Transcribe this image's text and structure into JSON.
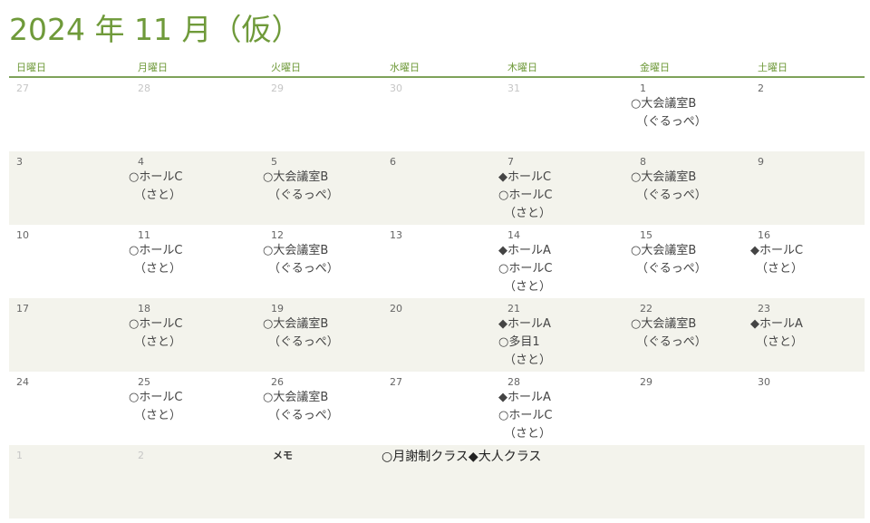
{
  "title": "2024 年 11 月（仮）",
  "weekdays": [
    "日曜日",
    "月曜日",
    "火曜日",
    "水曜日",
    "木曜日",
    "金曜日",
    "土曜日"
  ],
  "weeks": [
    {
      "shaded": false,
      "days": [
        {
          "num": "27",
          "faded": true,
          "entries": []
        },
        {
          "num": "28",
          "faded": true,
          "entries": []
        },
        {
          "num": "29",
          "faded": true,
          "entries": []
        },
        {
          "num": "30",
          "faded": true,
          "entries": []
        },
        {
          "num": "31",
          "faded": true,
          "entries": []
        },
        {
          "num": "1",
          "faded": false,
          "entries": [
            "○大会議室B",
            "（ぐるっぺ）"
          ]
        },
        {
          "num": "2",
          "faded": false,
          "entries": []
        }
      ]
    },
    {
      "shaded": true,
      "days": [
        {
          "num": "3",
          "faded": false,
          "entries": []
        },
        {
          "num": "4",
          "faded": false,
          "entries": [
            "○ホールC",
            "（さと）"
          ]
        },
        {
          "num": "5",
          "faded": false,
          "entries": [
            "○大会議室B",
            "（ぐるっぺ）"
          ]
        },
        {
          "num": "6",
          "faded": false,
          "entries": []
        },
        {
          "num": "7",
          "faded": false,
          "entries": [
            "◆ホールC",
            "○ホールC",
            "（さと）"
          ]
        },
        {
          "num": "8",
          "faded": false,
          "entries": [
            "○大会議室B",
            "（ぐるっぺ）"
          ]
        },
        {
          "num": "9",
          "faded": false,
          "entries": []
        }
      ]
    },
    {
      "shaded": false,
      "days": [
        {
          "num": "10",
          "faded": false,
          "entries": []
        },
        {
          "num": "11",
          "faded": false,
          "entries": [
            "○ホールC",
            "（さと）"
          ]
        },
        {
          "num": "12",
          "faded": false,
          "entries": [
            "○大会議室B",
            "（ぐるっぺ）"
          ]
        },
        {
          "num": "13",
          "faded": false,
          "entries": []
        },
        {
          "num": "14",
          "faded": false,
          "entries": [
            "◆ホールA",
            "○ホールC",
            "（さと）"
          ]
        },
        {
          "num": "15",
          "faded": false,
          "entries": [
            "○大会議室B",
            "（ぐるっぺ）"
          ]
        },
        {
          "num": "16",
          "faded": false,
          "entries": [
            "◆ホールC",
            "（さと）"
          ]
        }
      ]
    },
    {
      "shaded": true,
      "days": [
        {
          "num": "17",
          "faded": false,
          "entries": []
        },
        {
          "num": "18",
          "faded": false,
          "entries": [
            "○ホールC",
            "（さと）"
          ]
        },
        {
          "num": "19",
          "faded": false,
          "entries": [
            "○大会議室B",
            "（ぐるっぺ）"
          ]
        },
        {
          "num": "20",
          "faded": false,
          "entries": []
        },
        {
          "num": "21",
          "faded": false,
          "entries": [
            "◆ホールA",
            "○多目1",
            "（さと）"
          ]
        },
        {
          "num": "22",
          "faded": false,
          "entries": [
            "○大会議室B",
            "（ぐるっぺ）"
          ]
        },
        {
          "num": "23",
          "faded": false,
          "entries": [
            "◆ホールA",
            "（さと）"
          ]
        }
      ]
    },
    {
      "shaded": false,
      "days": [
        {
          "num": "24",
          "faded": false,
          "entries": []
        },
        {
          "num": "25",
          "faded": false,
          "entries": [
            "○ホールC",
            "（さと）"
          ]
        },
        {
          "num": "26",
          "faded": false,
          "entries": [
            "○大会議室B",
            "（ぐるっぺ）"
          ]
        },
        {
          "num": "27",
          "faded": false,
          "entries": []
        },
        {
          "num": "28",
          "faded": false,
          "entries": [
            "◆ホールA",
            "○ホールC",
            "（さと）"
          ]
        },
        {
          "num": "29",
          "faded": false,
          "entries": []
        },
        {
          "num": "30",
          "faded": false,
          "entries": []
        }
      ]
    },
    {
      "shaded": true,
      "days": [
        {
          "num": "1",
          "faded": true,
          "entries": []
        },
        {
          "num": "2",
          "faded": true,
          "entries": []
        }
      ]
    }
  ],
  "memo": {
    "label": "メモ",
    "text": "○月謝制クラス◆大人クラス"
  },
  "colors": {
    "title": "#6f9a3a",
    "rule": "#7ea25a",
    "shade": "#f3f3ec"
  }
}
